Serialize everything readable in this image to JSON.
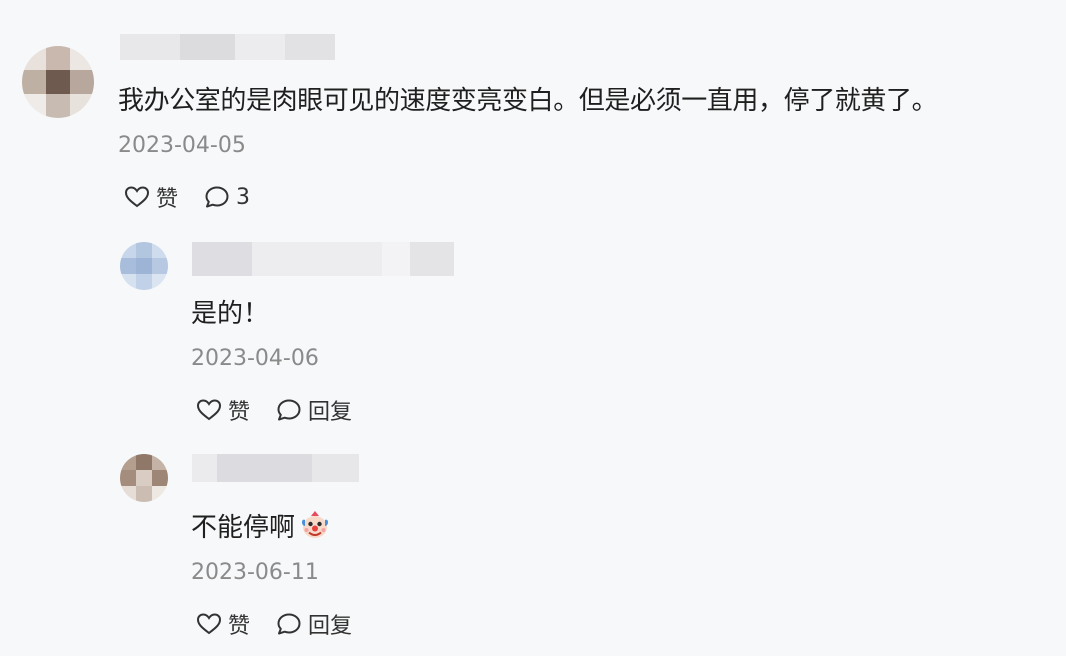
{
  "comments": [
    {
      "text": "我办公室的是肉眼可见的速度变亮变白。但是必须一直用，停了就黄了。",
      "date": "2023-04-05",
      "like_label": "赞",
      "reply_count": "3"
    }
  ],
  "replies": [
    {
      "text": "是的！",
      "date": "2023-04-06",
      "like_label": "赞",
      "reply_label": "回复"
    },
    {
      "text": "不能停啊",
      "emoji": "clown-face-icon",
      "date": "2023-06-11",
      "like_label": "赞",
      "reply_label": "回复"
    }
  ]
}
